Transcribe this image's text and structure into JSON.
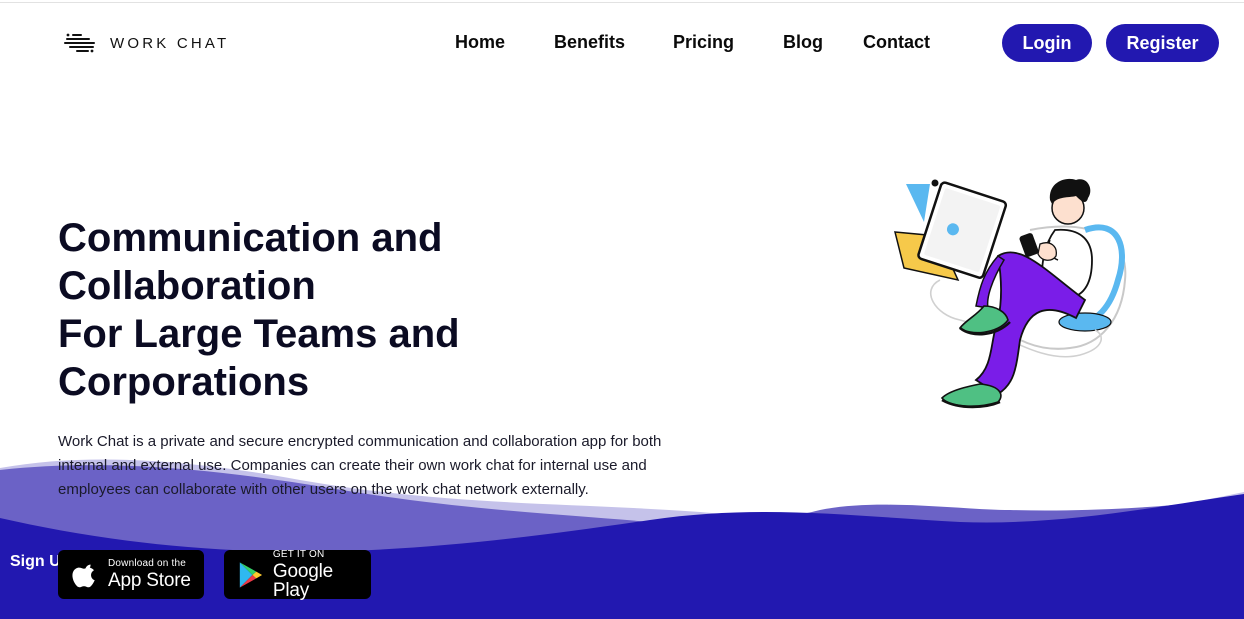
{
  "brand": {
    "name": "WORK CHAT",
    "logo_icon": "swirl-logo-icon"
  },
  "nav": {
    "items": [
      "Home",
      "Benefits",
      "Pricing",
      "Blog",
      "Contact"
    ],
    "login_label": "Login",
    "register_label": "Register"
  },
  "hero": {
    "title_lines": [
      "Communication and",
      "Collaboration",
      "For Large Teams and",
      "Corporations"
    ],
    "description": "Work Chat is a private and secure encrypted communication and collaboration app for both internal and external use. Companies can create their own work chat for internal use and employees can collaborate with other users on the work chat network externally.",
    "signup_text": "Sign U"
  },
  "stores": {
    "app_store": {
      "small": "Download on the",
      "big": "App Store",
      "icon": "apple-icon"
    },
    "google_play": {
      "small": "GET IT ON",
      "big": "Google Play",
      "icon": "google-play-icon"
    }
  },
  "colors": {
    "primary": "#2218b0",
    "wave_mid": "#6b62c6",
    "wave_light": "#c5c2ea",
    "text_dark": "#0b0b22",
    "illustration_purple": "#7a1de8",
    "illustration_green": "#4fc083",
    "illustration_yellow": "#f6c94a",
    "illustration_blue": "#5ab8f0"
  }
}
